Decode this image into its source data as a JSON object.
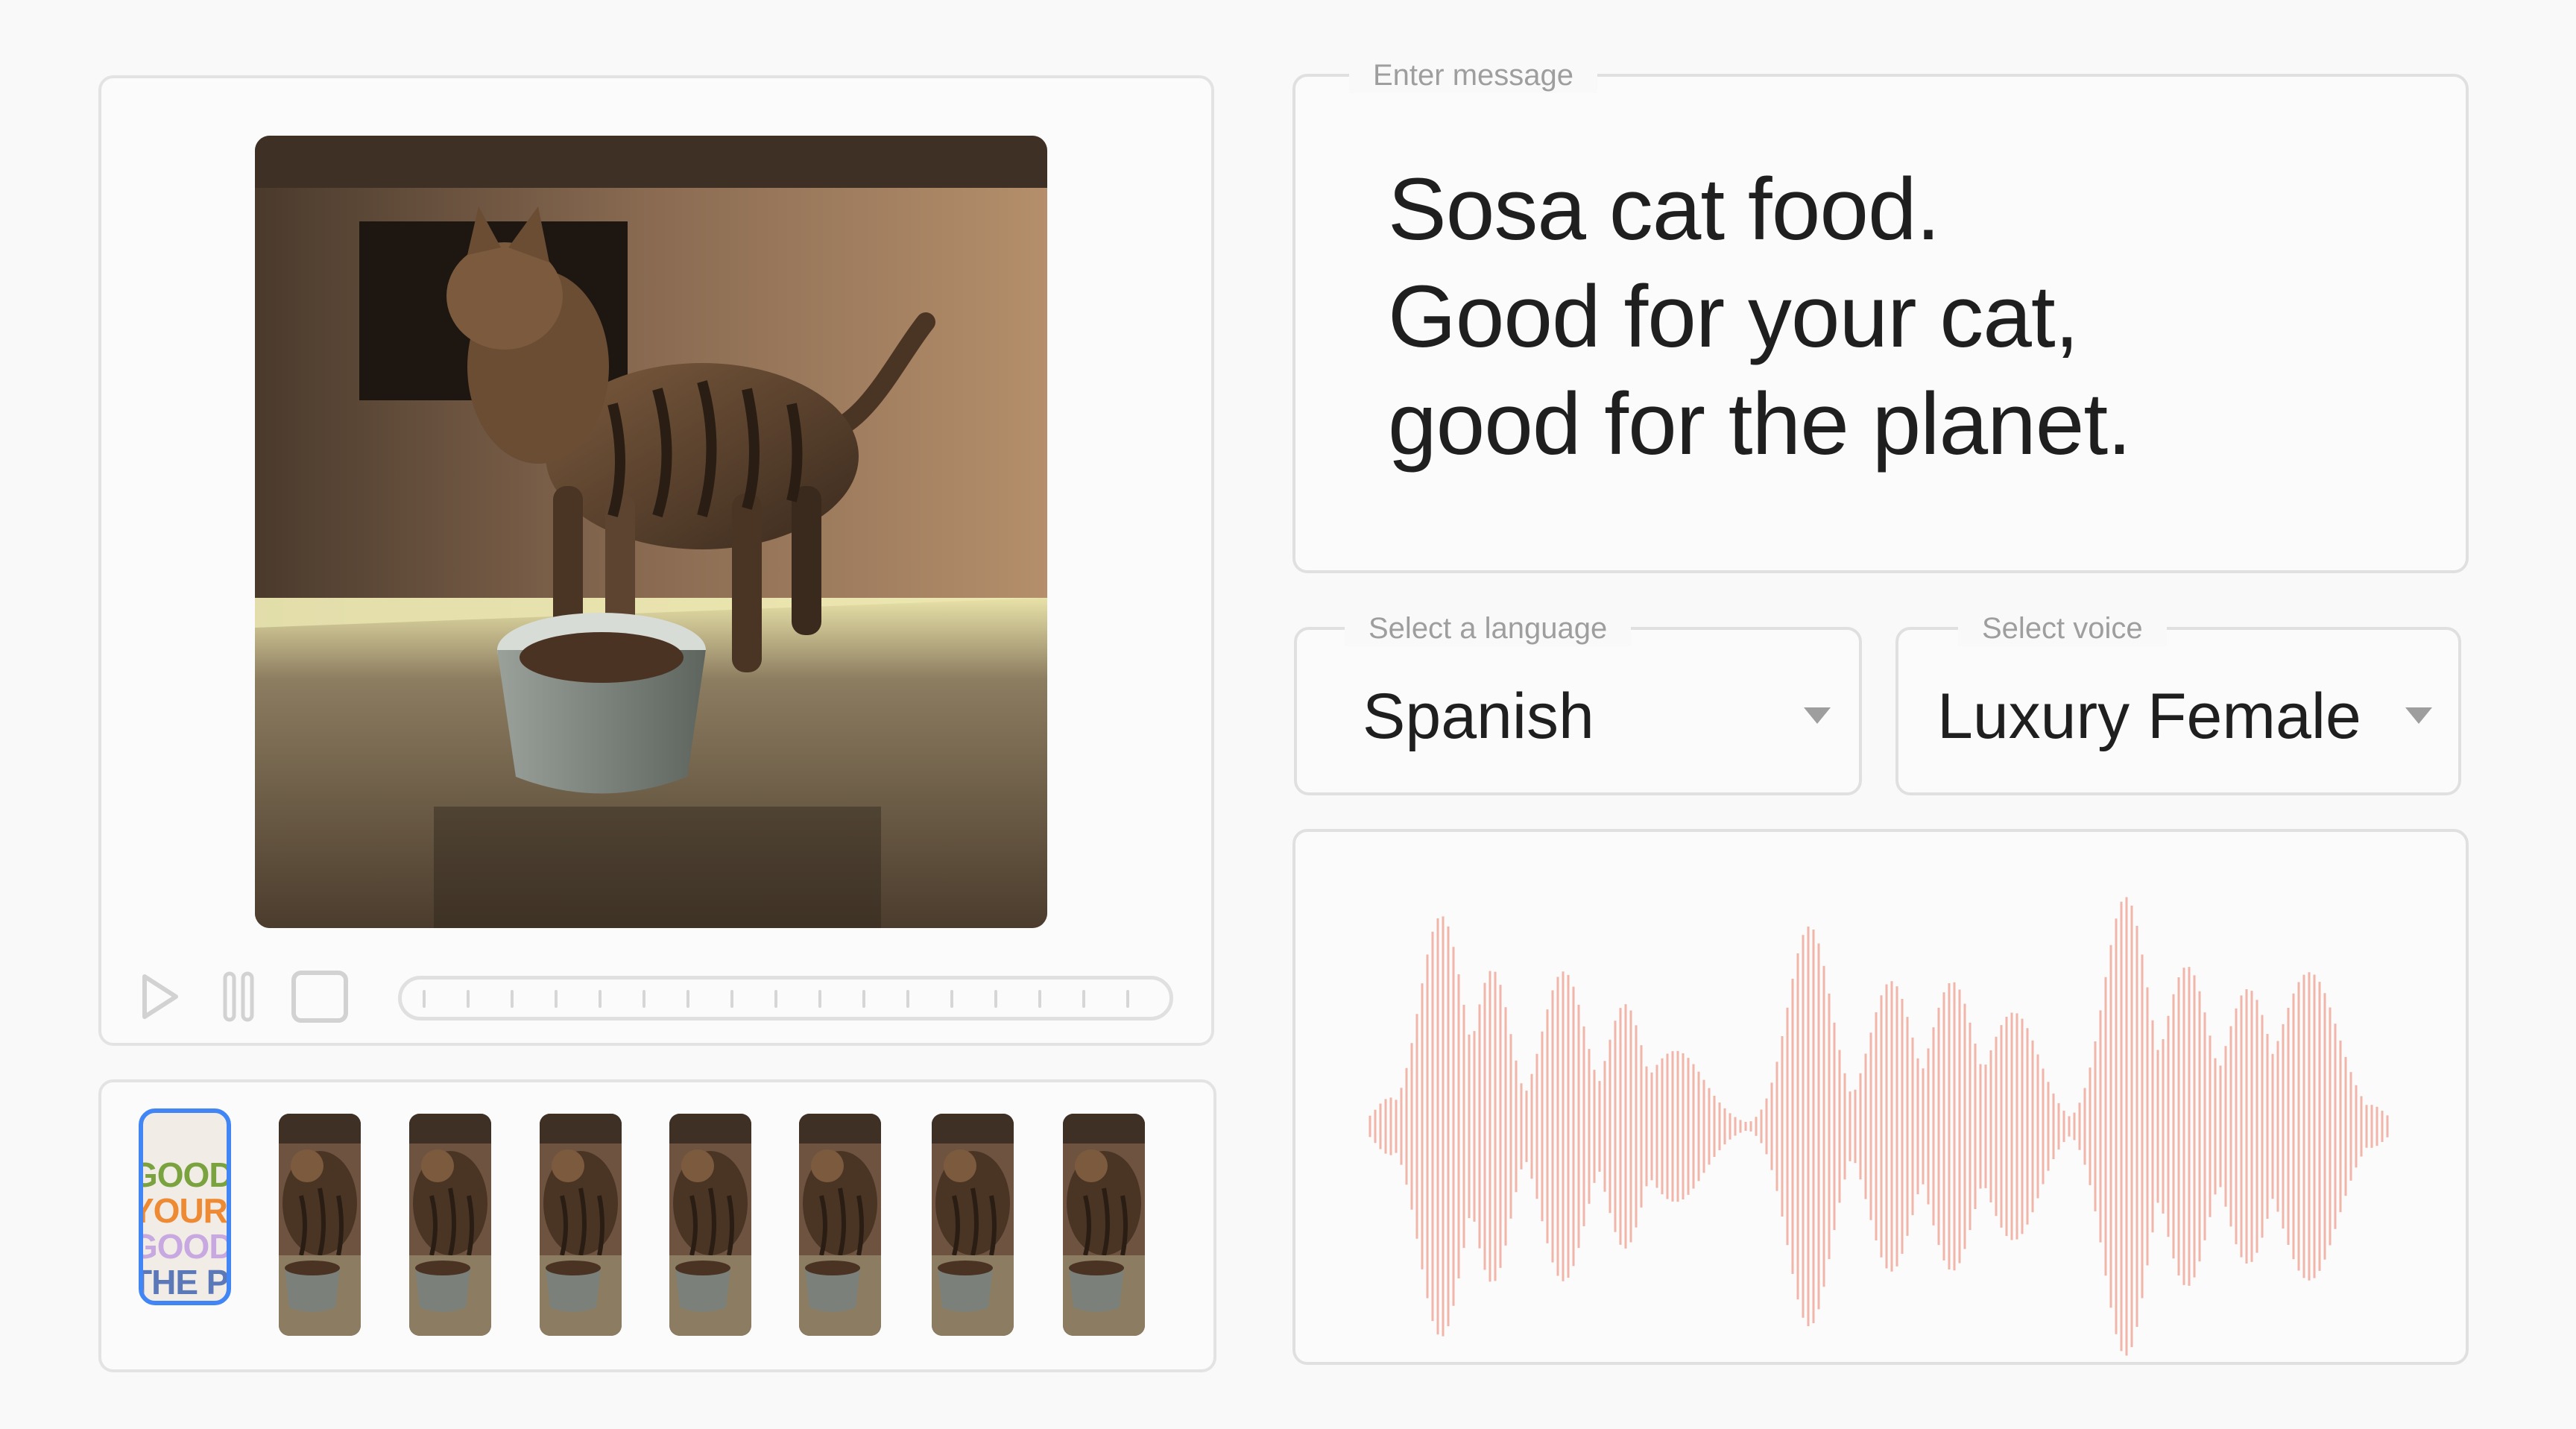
{
  "player": {
    "controls": [
      {
        "name": "play-button",
        "icon": "play-icon"
      },
      {
        "name": "pause-button",
        "icon": "pause-icon"
      },
      {
        "name": "stop-button",
        "icon": "stop-icon"
      }
    ],
    "timeline_ticks": 17
  },
  "filmstrip": {
    "title_card_lines": [
      {
        "text": "GOOD FOR",
        "color": "#7aa23f"
      },
      {
        "text": "YOUR PLANET",
        "color": "#ee8a34"
      },
      {
        "text": "GOOD FOR",
        "color": "#c8a8e0"
      },
      {
        "text": "THE PLANET",
        "color": "#5b79b8"
      }
    ],
    "selected_color": "#4285f4",
    "frame_count": 7
  },
  "message": {
    "legend": "Enter message",
    "lines": [
      "Sosa cat food.",
      "Good for your cat,",
      "good for the planet."
    ]
  },
  "language": {
    "legend": "Select a language",
    "value": "Spanish"
  },
  "voice": {
    "legend": "Select voice",
    "value": "Luxury Female"
  },
  "waveform": {
    "color": "#f2b5aa"
  }
}
